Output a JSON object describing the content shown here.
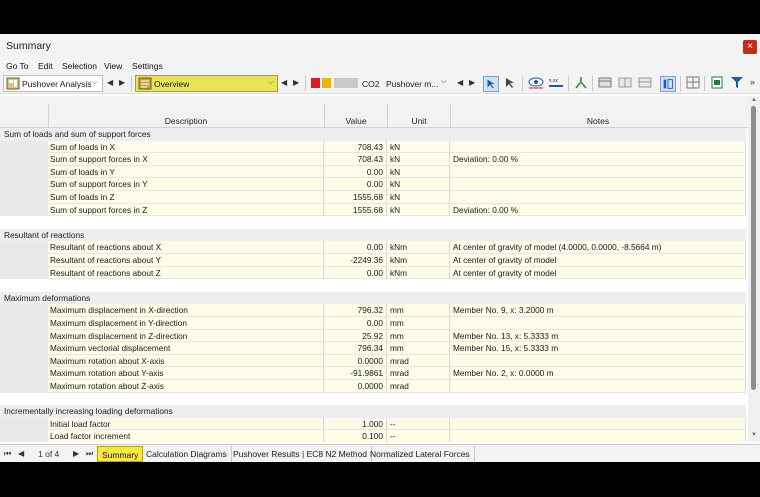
{
  "window": {
    "title": "Summary",
    "close_label": "×"
  },
  "menu": [
    "Go To",
    "Edit",
    "Selection",
    "View",
    "Settings"
  ],
  "toolbar": {
    "analysis_label": "Pushover Analysis",
    "view_label": "Overview",
    "combo_label": "CO2",
    "method_label": "Pushover m...",
    "more_label": "»",
    "accent_color": "#e8e45a"
  },
  "table": {
    "headers": {
      "description": "Description",
      "value": "Value",
      "unit": "Unit",
      "notes": "Notes"
    },
    "rows": [
      {
        "kind": "group",
        "label": "Sum of loads and sum of support forces"
      },
      {
        "kind": "data",
        "desc": "Sum of loads in X",
        "value": "708.43",
        "unit": "kN",
        "note": ""
      },
      {
        "kind": "data",
        "desc": "Sum of support forces in X",
        "value": "708.43",
        "unit": "kN",
        "note": "Deviation: 0.00 %"
      },
      {
        "kind": "data",
        "desc": "Sum of loads in Y",
        "value": "0.00",
        "unit": "kN",
        "note": ""
      },
      {
        "kind": "data",
        "desc": "Sum of support forces in Y",
        "value": "0.00",
        "unit": "kN",
        "note": ""
      },
      {
        "kind": "data",
        "desc": "Sum of loads in Z",
        "value": "1555.68",
        "unit": "kN",
        "note": ""
      },
      {
        "kind": "data",
        "desc": "Sum of support forces in Z",
        "value": "1555.68",
        "unit": "kN",
        "note": "Deviation: 0.00 %"
      },
      {
        "kind": "blank"
      },
      {
        "kind": "group",
        "label": "Resultant of reactions"
      },
      {
        "kind": "data",
        "desc": "Resultant of reactions about X",
        "value": "0.00",
        "unit": "kNm",
        "note": "At center of gravity of model (4.0000, 0.0000, -8.5664 m)"
      },
      {
        "kind": "data",
        "desc": "Resultant of reactions about Y",
        "value": "-2249.36",
        "unit": "kNm",
        "note": "At center of gravity of model"
      },
      {
        "kind": "data",
        "desc": "Resultant of reactions about Z",
        "value": "0.00",
        "unit": "kNm",
        "note": "At center of gravity of model"
      },
      {
        "kind": "blank"
      },
      {
        "kind": "group",
        "label": "Maximum deformations"
      },
      {
        "kind": "data",
        "desc": "Maximum displacement in X-direction",
        "value": "796.32",
        "unit": "mm",
        "note": "Member No. 9, x: 3.2000 m"
      },
      {
        "kind": "data",
        "desc": "Maximum displacement in Y-direction",
        "value": "0.00",
        "unit": "mm",
        "note": ""
      },
      {
        "kind": "data",
        "desc": "Maximum displacement in Z-direction",
        "value": "25.92",
        "unit": "mm",
        "note": "Member No. 13, x: 5.3333 m"
      },
      {
        "kind": "data",
        "desc": "Maximum vectorial displacement",
        "value": "796.34",
        "unit": "mm",
        "note": "Member No. 15, x: 5.3333 m"
      },
      {
        "kind": "data",
        "desc": "Maximum rotation about X-axis",
        "value": "0.0000",
        "unit": "mrad",
        "note": ""
      },
      {
        "kind": "data",
        "desc": "Maximum rotation about Y-axis",
        "value": "-91.9861",
        "unit": "mrad",
        "note": "Member No. 2, x: 0.0000 m"
      },
      {
        "kind": "data",
        "desc": "Maximum rotation about Z-axis",
        "value": "0.0000",
        "unit": "mrad",
        "note": ""
      },
      {
        "kind": "blank"
      },
      {
        "kind": "group",
        "label": "Incrementally increasing loading deformations"
      },
      {
        "kind": "data",
        "desc": "Initial load factor",
        "value": "1.000",
        "unit": "--",
        "note": ""
      },
      {
        "kind": "data",
        "desc": "Load factor increment",
        "value": "0.100",
        "unit": "--",
        "note": ""
      }
    ]
  },
  "pager": {
    "text": "1 of 4"
  },
  "tabs": [
    {
      "label": "Summary",
      "active": true
    },
    {
      "label": "Calculation Diagrams",
      "active": false
    },
    {
      "label": "Pushover Results | EC8 N2 Method",
      "active": false
    },
    {
      "label": "Normalized Lateral Forces",
      "active": false
    }
  ]
}
